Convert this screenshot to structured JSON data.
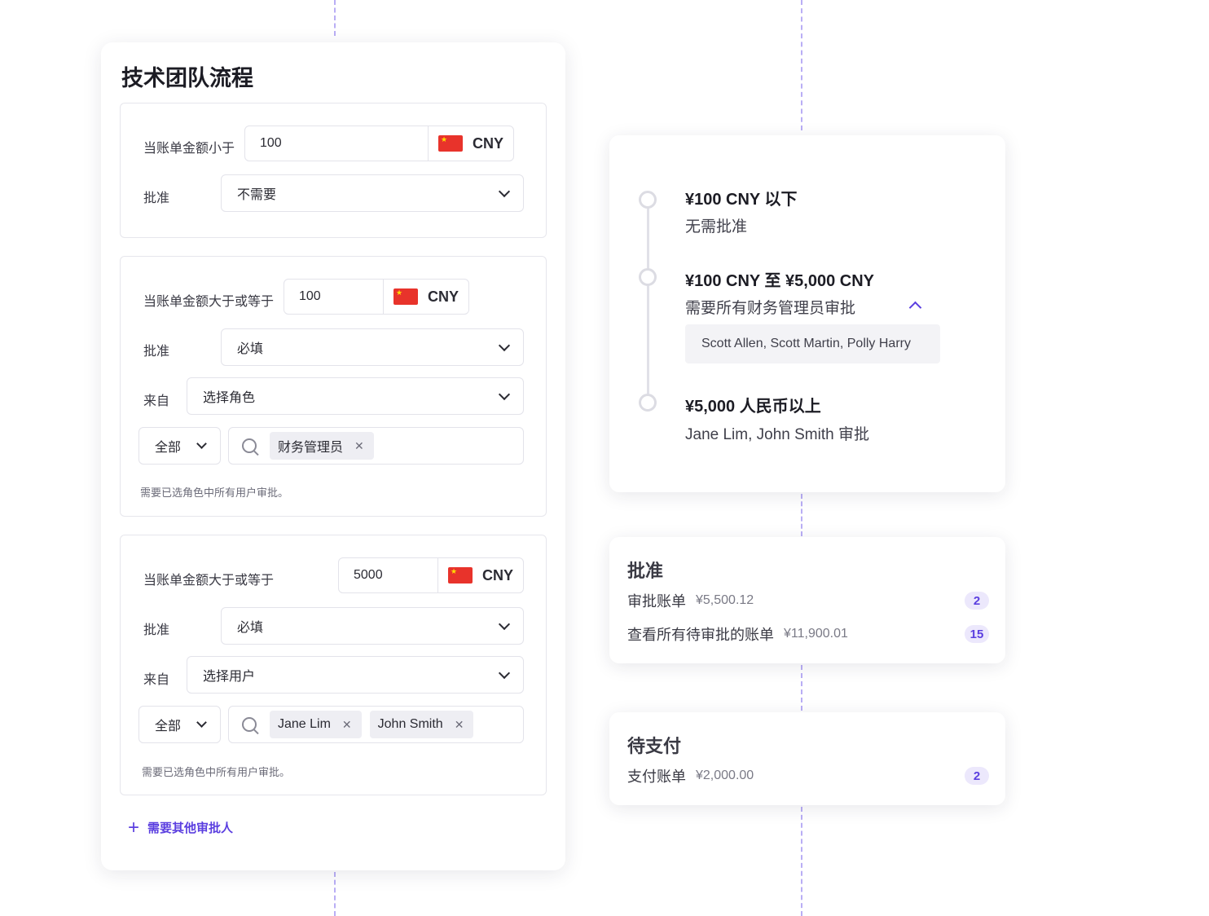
{
  "left": {
    "title": "技术团队流程",
    "rule1": {
      "condition": "当账单金额小于",
      "amount": "100",
      "currency": "CNY",
      "approval_label": "批准",
      "approval_value": "不需要"
    },
    "rule2": {
      "condition": "当账单金额大于或等于",
      "amount": "100",
      "currency": "CNY",
      "approval_label": "批准",
      "approval_value": "必填",
      "from_label": "来自",
      "from_value": "选择角色",
      "scope": "全部",
      "chips": [
        "财务管理员"
      ],
      "hint": "需要已选角色中所有用户审批。"
    },
    "rule3": {
      "condition": "当账单金额大于或等于",
      "amount": "5000",
      "currency": "CNY",
      "approval_label": "批准",
      "approval_value": "必填",
      "from_label": "来自",
      "from_value": "选择用户",
      "scope": "全部",
      "chips": [
        "Jane Lim",
        "John Smith"
      ],
      "hint": "需要已选角色中所有用户审批。"
    },
    "add_approver": "需要其他审批人"
  },
  "timeline": {
    "items": [
      {
        "title": "¥100 CNY 以下",
        "subtitle": "无需批准"
      },
      {
        "title": "¥100 CNY 至 ¥5,000 CNY",
        "subtitle": "需要所有财务管理员审批",
        "names": "Scott Allen, Scott Martin, Polly Harry"
      },
      {
        "title": "¥5,000 人民币以上",
        "subtitle": "Jane Lim, John Smith 审批"
      }
    ]
  },
  "approval_card": {
    "title": "批准",
    "rows": [
      {
        "name": "审批账单",
        "amount": "¥5,500.12",
        "badge": "2"
      },
      {
        "name": "查看所有待审批的账单",
        "amount": "¥11,900.01",
        "badge": "15"
      }
    ]
  },
  "payment_card": {
    "title": "待支付",
    "rows": [
      {
        "name": "支付账单",
        "amount": "¥2,000.00",
        "badge": "2"
      }
    ]
  },
  "colors": {
    "accent": "#5b3fe0",
    "dash": "#b9aef5",
    "flag_red": "#e8332b"
  }
}
